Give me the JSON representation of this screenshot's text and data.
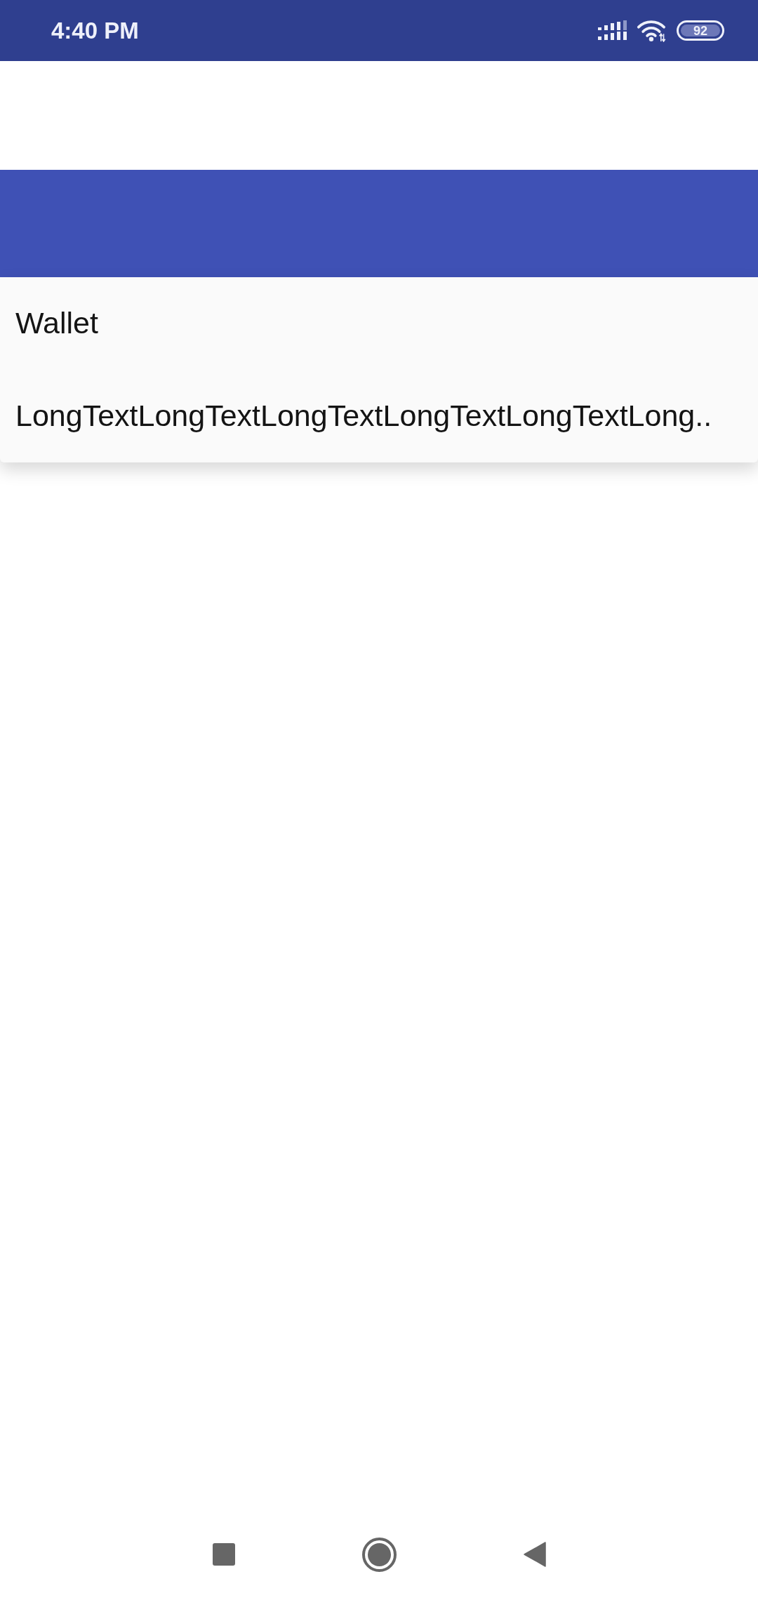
{
  "status_bar": {
    "time": "4:40 PM",
    "battery": "92"
  },
  "menu": {
    "items": [
      {
        "label": "Wallet"
      },
      {
        "label": "LongTextLongTextLongTextLongTextLongTextLong.."
      }
    ]
  }
}
